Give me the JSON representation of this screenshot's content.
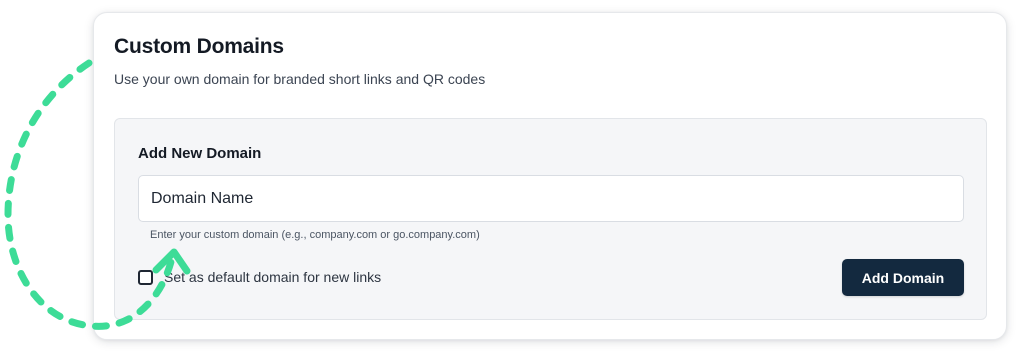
{
  "header": {
    "title": "Custom Domains",
    "subtitle": "Use your own domain for branded short links and QR codes"
  },
  "add_domain": {
    "title": "Add New Domain",
    "domain_input": {
      "value": "",
      "placeholder": "Domain Name"
    },
    "helper_text": "Enter your custom domain (e.g., company.com or go.company.com)",
    "default_checkbox": {
      "label": "Set as default domain for new links",
      "checked": false
    },
    "submit_label": "Add Domain"
  },
  "annotation": {
    "icon": "dashed-curved-arrow-icon",
    "color": "#3ddc97"
  },
  "colors": {
    "primary_button": "#13293f",
    "panel_background": "#f5f6f8",
    "text_primary": "#141a24"
  }
}
